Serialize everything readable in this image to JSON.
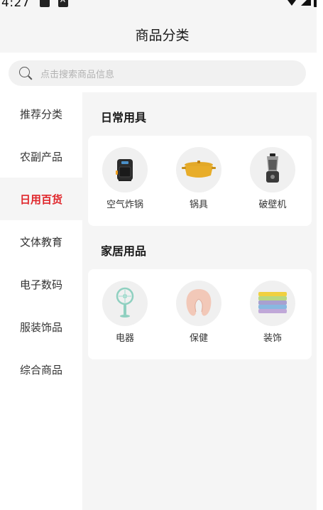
{
  "status_bar": {
    "time": "4:27"
  },
  "header": {
    "title": "商品分类"
  },
  "search": {
    "placeholder": "点击搜索商品信息"
  },
  "sidebar": {
    "items": [
      {
        "label": "推荐分类"
      },
      {
        "label": "农副产品"
      },
      {
        "label": "日用百货"
      },
      {
        "label": "文体教育"
      },
      {
        "label": "电子数码"
      },
      {
        "label": "服装饰品"
      },
      {
        "label": "综合商品"
      }
    ],
    "active_label": "日用百货"
  },
  "sections": [
    {
      "title": "日常用具",
      "items": [
        {
          "label": "空气炸锅",
          "icon": "air-fryer-icon"
        },
        {
          "label": "锅具",
          "icon": "pot-icon"
        },
        {
          "label": "破壁机",
          "icon": "blender-icon"
        }
      ]
    },
    {
      "title": "家居用品",
      "items": [
        {
          "label": "电器",
          "icon": "fan-icon"
        },
        {
          "label": "保健",
          "icon": "neck-pillow-icon"
        },
        {
          "label": "装饰",
          "icon": "towels-icon"
        }
      ]
    }
  ],
  "colors": {
    "accent": "#e0262b",
    "background": "#f5f5f5"
  }
}
